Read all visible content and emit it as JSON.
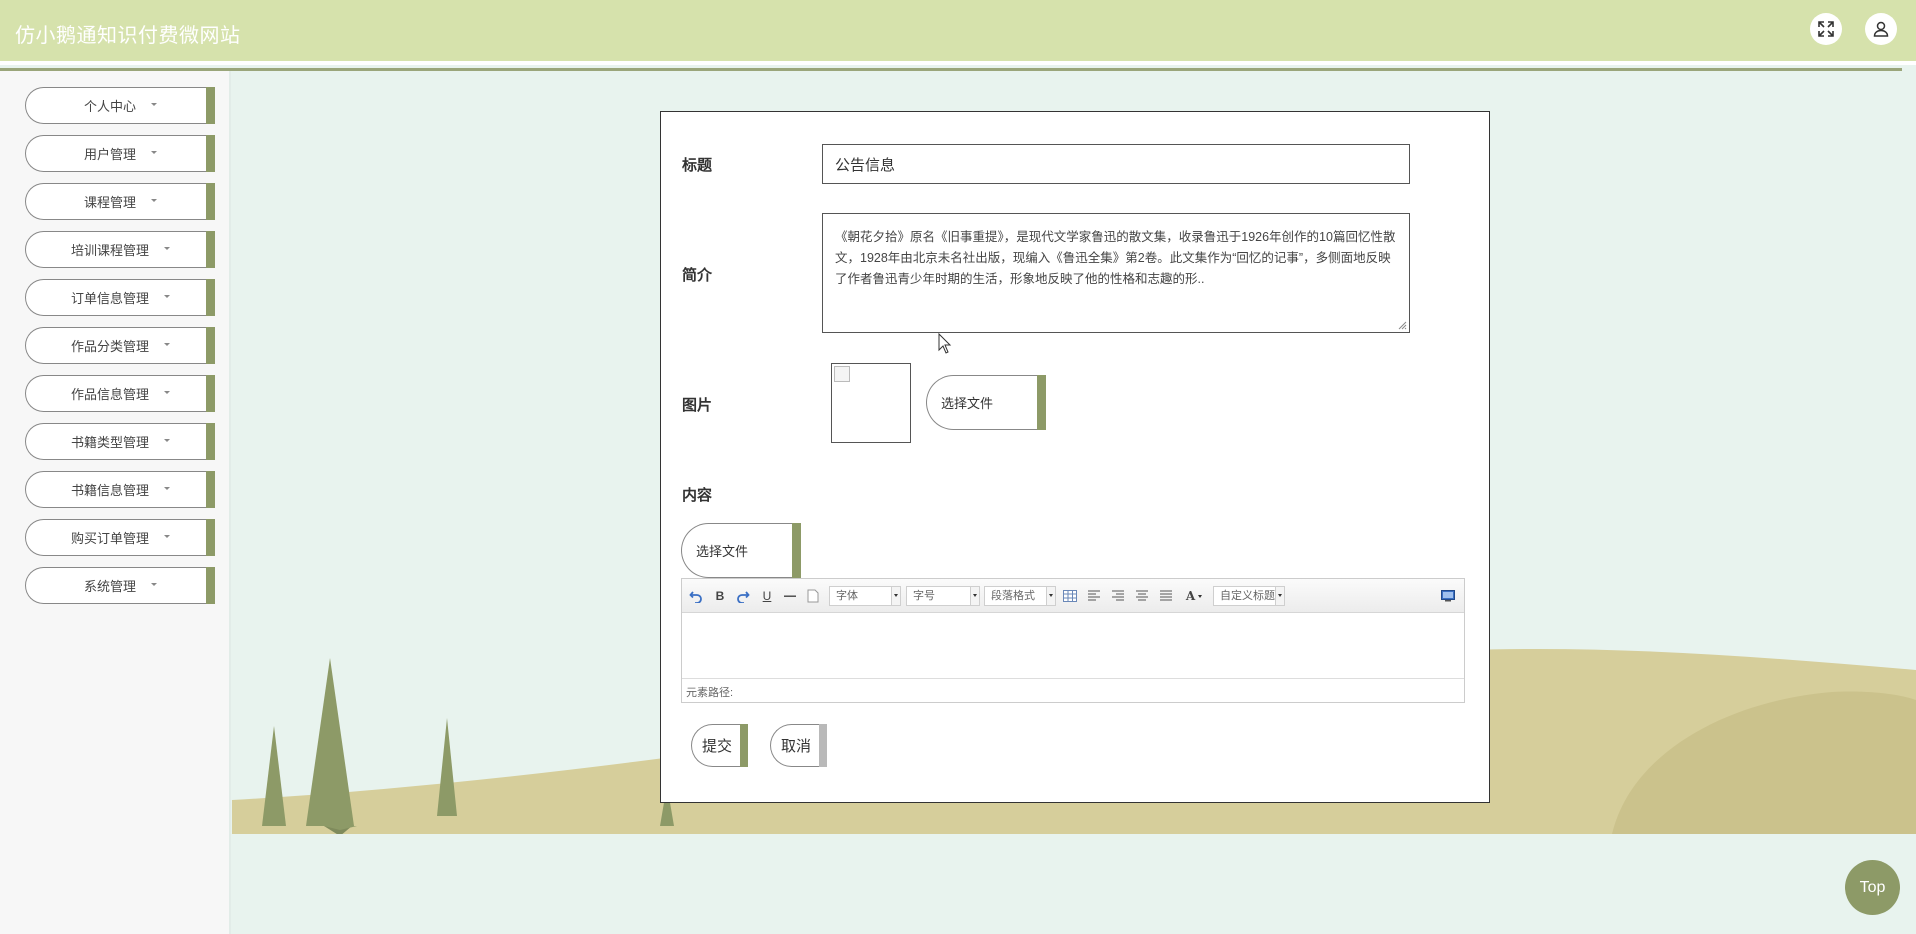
{
  "header": {
    "site_title": "仿小鹅通知识付费微网站",
    "fullscreen_icon": "fullscreen-icon",
    "user_icon": "user-icon"
  },
  "sidebar": {
    "items": [
      {
        "label": "个人中心"
      },
      {
        "label": "用户管理"
      },
      {
        "label": "课程管理"
      },
      {
        "label": "培训课程管理"
      },
      {
        "label": "订单信息管理"
      },
      {
        "label": "作品分类管理"
      },
      {
        "label": "作品信息管理"
      },
      {
        "label": "书籍类型管理"
      },
      {
        "label": "书籍信息管理"
      },
      {
        "label": "购买订单管理"
      },
      {
        "label": "系统管理"
      }
    ]
  },
  "form": {
    "title_label": "标题",
    "title_value": "公告信息",
    "intro_label": "简介",
    "intro_value": "《朝花夕拾》原名《旧事重提》，是现代文学家鲁迅的散文集，收录鲁迅于1926年创作的10篇回忆性散文，1928年由北京未名社出版，现编入《鲁迅全集》第2卷。此文集作为“回忆的记事”，多侧面地反映了作者鲁迅青少年时期的生活，形象地反映了他的性格和志趣的形..",
    "image_label": "图片",
    "image_file_button": "选择文件",
    "content_label": "内容",
    "content_file_button": "选择文件",
    "submit_button": "提交",
    "cancel_button": "取消"
  },
  "editor": {
    "toolbar": {
      "font_family": "字体",
      "font_size": "字号",
      "paragraph": "段落格式",
      "custom_title": "自定义标题",
      "bold": "B",
      "underline": "U",
      "font_color": "A"
    },
    "element_path_label": "元素路径:"
  },
  "back_to_top": "Top",
  "colors": {
    "header_bg": "#d6e2ac",
    "accent": "#8d9a67",
    "page_bg": "#e8f3ee"
  }
}
